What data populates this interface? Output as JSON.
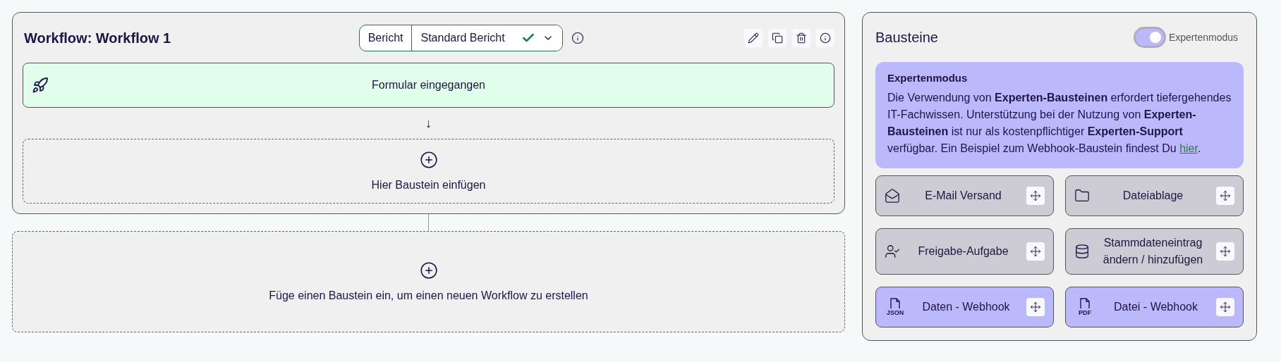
{
  "workflow": {
    "title": "Workflow: Workflow 1",
    "report": {
      "label": "Bericht",
      "value": "Standard Bericht",
      "valid": true
    },
    "trigger": {
      "label": "Formular eingegangen"
    },
    "arrow": "↓",
    "dropzone": {
      "label": "Hier Baustein einfügen"
    }
  },
  "new_workflow": {
    "label": "Füge einen Baustein ein, um einen neuen Workflow zu erstellen"
  },
  "sidebar": {
    "title": "Bausteine",
    "expert_toggle": {
      "label": "Expertenmodus",
      "on": true
    },
    "notice": {
      "title": "Expertenmodus",
      "text": "Die Verwendung von **Experten-Bausteinen** erfordert tiefergehendes IT-Fachwissen. Unterstützung bei der Nutzung von **Experten-Bausteinen** ist nur als kostenpflichtiger **Experten-Support** verfügbar. Ein Beispiel zum Webhook-Baustein findest Du",
      "link": "hier",
      "after": "."
    },
    "blocks": [
      {
        "label": "E-Mail Versand",
        "kind": "standard"
      },
      {
        "label": "Dateiablage",
        "kind": "standard"
      },
      {
        "label": "Freigabe-Aufgabe",
        "kind": "standard"
      },
      {
        "label": "Stammdateneintrag ändern / hinzufügen",
        "kind": "standard"
      },
      {
        "label": "Daten - Webhook",
        "kind": "expert",
        "file_tag": "JSON"
      },
      {
        "label": "Datei - Webhook",
        "kind": "expert",
        "file_tag": "PDF"
      }
    ]
  }
}
